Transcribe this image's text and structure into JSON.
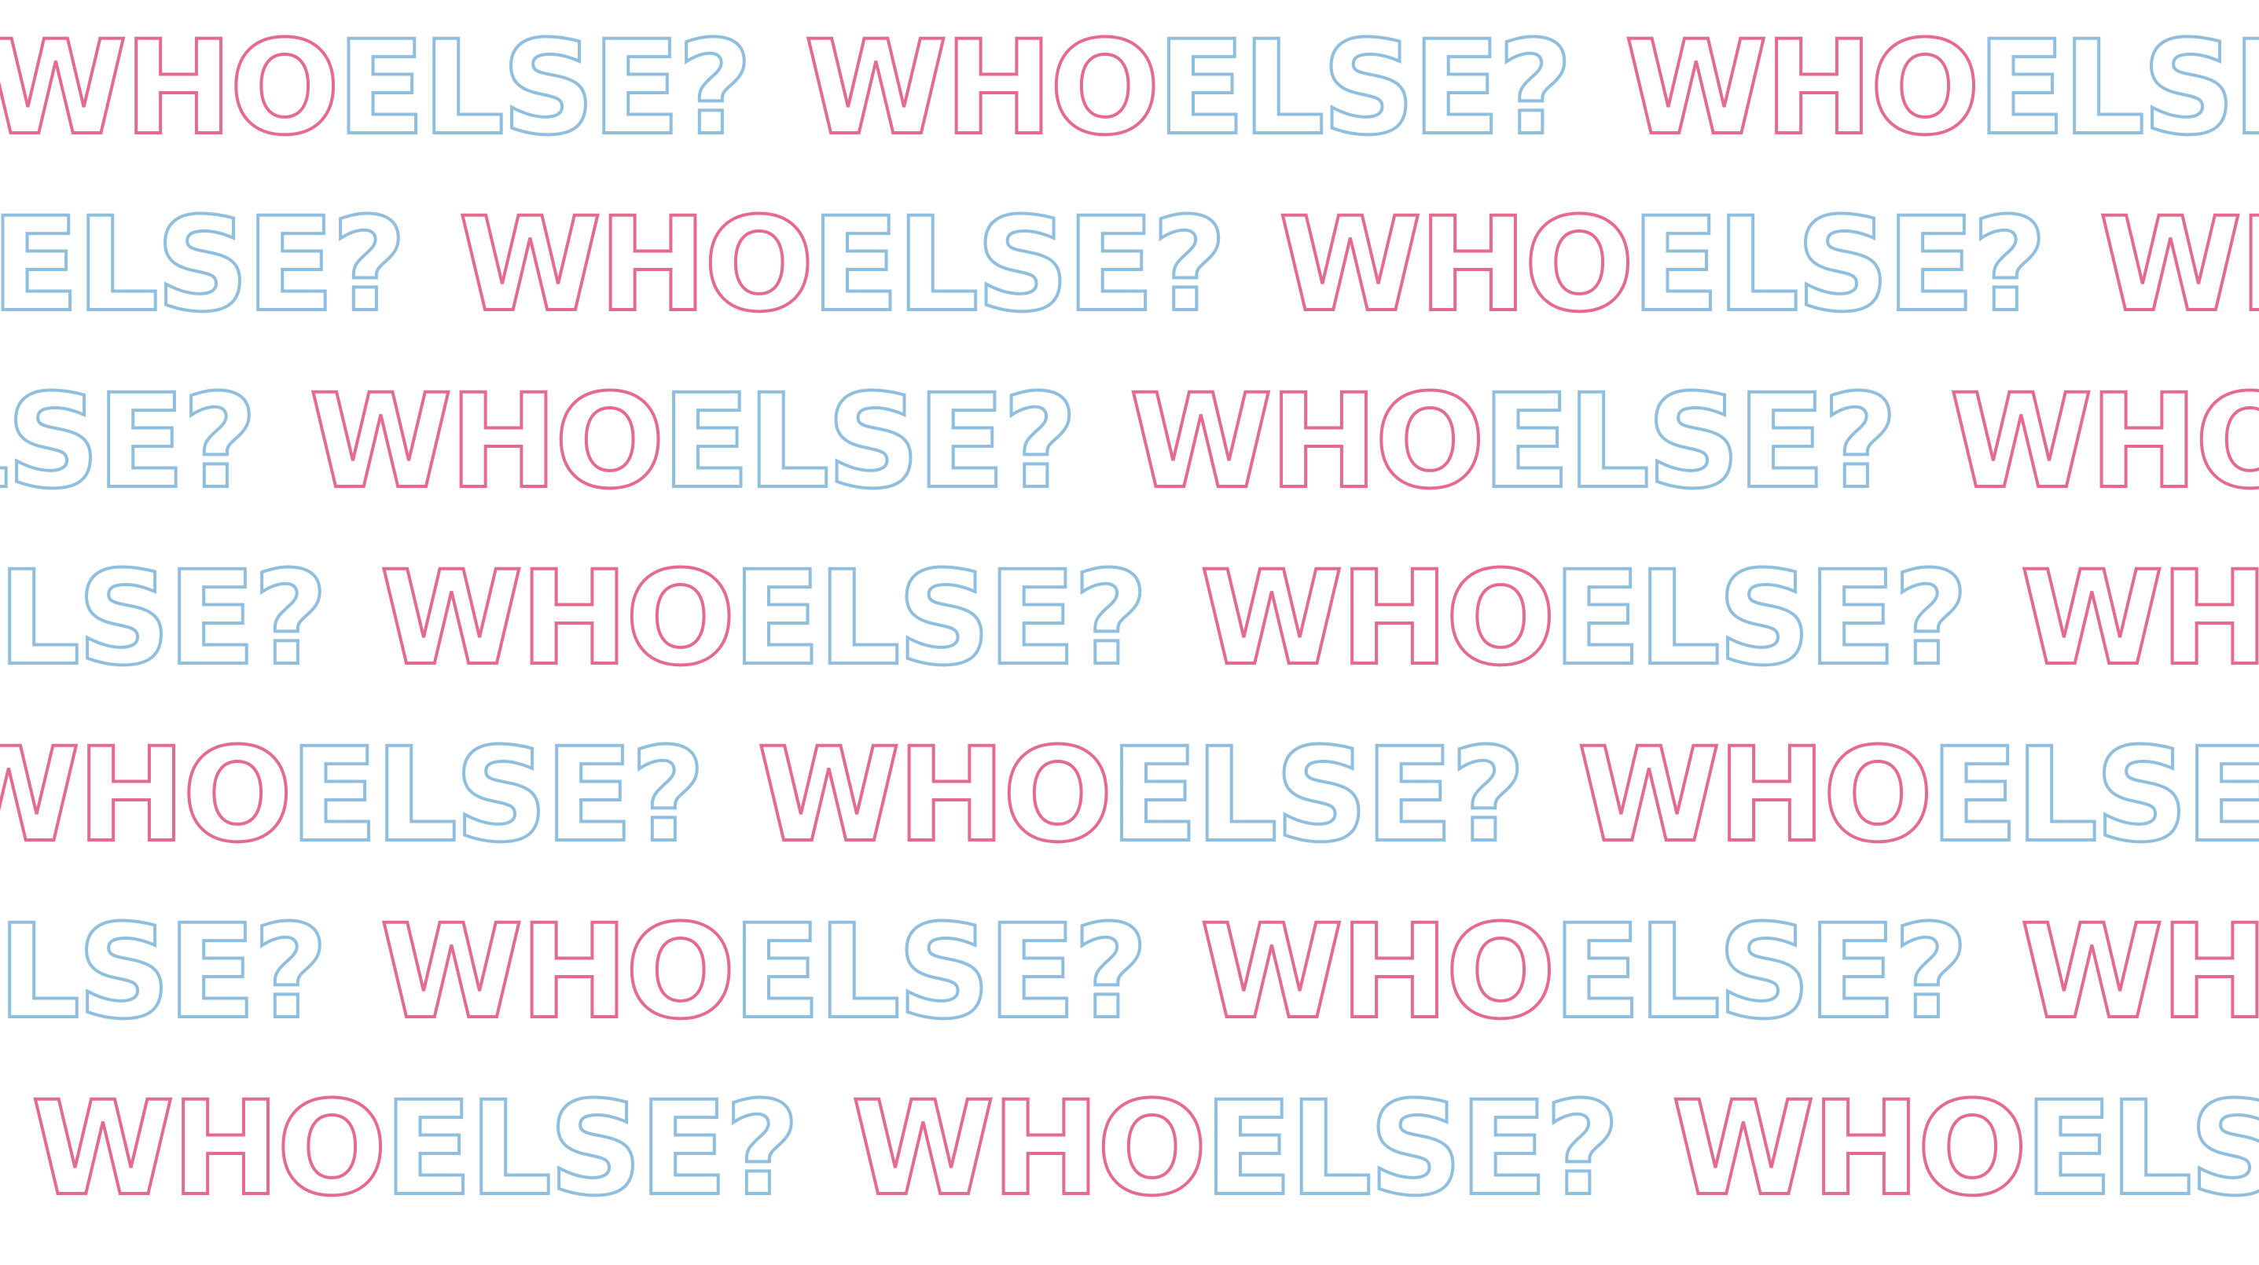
{
  "pattern": {
    "pink_part": "WHO",
    "blue_part": "ELSE?",
    "colors": {
      "pink": "#e56b8e",
      "blue": "#8fbedf",
      "background": "#ffffff"
    }
  }
}
